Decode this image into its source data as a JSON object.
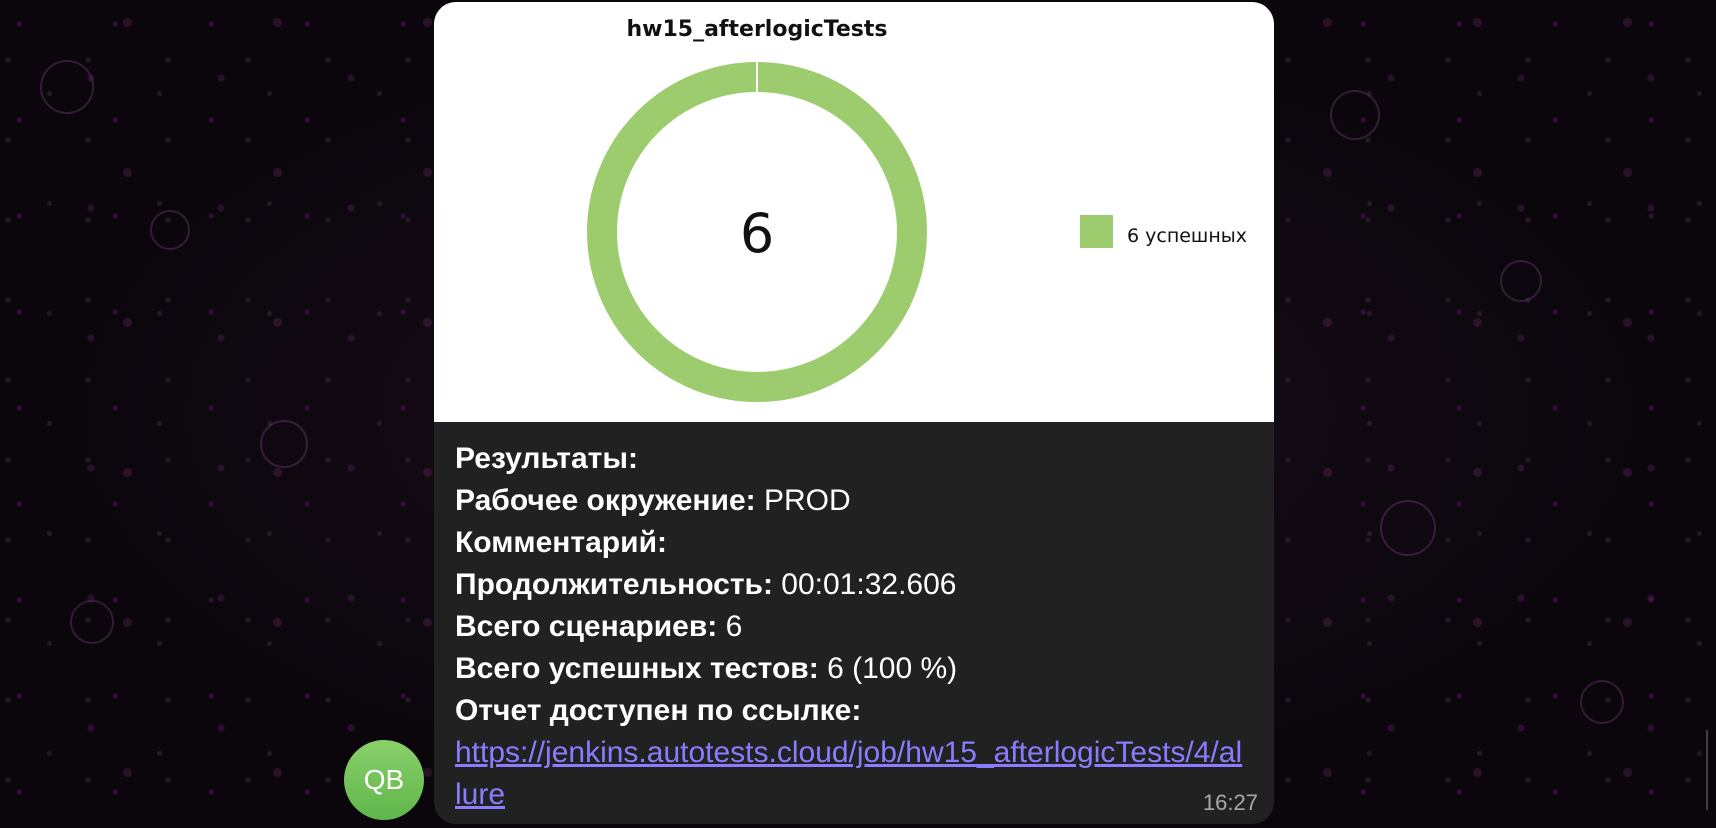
{
  "chat": {
    "avatar_initials": "QB",
    "message_time": "16:27",
    "link_color": "#8b7cff",
    "bubble_color": "#212121"
  },
  "chart_data": {
    "type": "pie",
    "title": "hw15_afterlogicTests",
    "center_label": "6",
    "slices": [
      {
        "name": "6 успешных",
        "value": 6,
        "color": "#9ccc6e"
      }
    ],
    "legend_position": "right",
    "donut": true
  },
  "caption": {
    "results_label": "Результаты:",
    "environment_label": "Рабочее окружение:",
    "environment_value": "PROD",
    "comment_label": "Комментарий:",
    "duration_label": "Продолжительность:",
    "duration_value": "00:01:32.606",
    "scenarios_label": "Всего сценариев:",
    "scenarios_value": "6",
    "passed_label": "Всего успешных тестов:",
    "passed_value": "6 (100 %)",
    "report_label": "Отчет доступен по ссылке:",
    "report_link": "https://jenkins.autotests.cloud/job/hw15_afterlogicTests/4/allure"
  }
}
